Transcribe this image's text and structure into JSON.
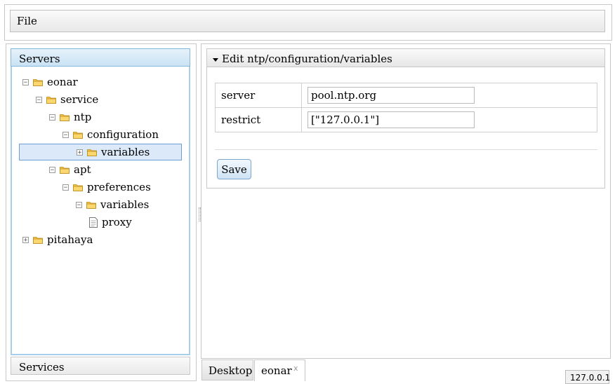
{
  "menu": {
    "file_label": "File"
  },
  "left_panel": {
    "servers_header": "Servers",
    "services_header": "Services",
    "tree": [
      {
        "label": "eonar",
        "type": "folder",
        "expander": "−"
      },
      {
        "label": "service",
        "type": "folder",
        "expander": "−"
      },
      {
        "label": "ntp",
        "type": "folder",
        "expander": "−"
      },
      {
        "label": "configuration",
        "type": "folder",
        "expander": "−"
      },
      {
        "label": "variables",
        "type": "folder",
        "expander": "+",
        "selected": true
      },
      {
        "label": "apt",
        "type": "folder",
        "expander": "−"
      },
      {
        "label": "preferences",
        "type": "folder",
        "expander": "−"
      },
      {
        "label": "variables",
        "type": "folder",
        "expander": "−"
      },
      {
        "label": "proxy",
        "type": "file"
      },
      {
        "label": "pitahaya",
        "type": "folder",
        "expander": "+"
      }
    ]
  },
  "editor": {
    "title": "Edit ntp/configuration/variables",
    "rows": [
      {
        "key": "server",
        "value": "pool.ntp.org"
      },
      {
        "key": "restrict",
        "value": "[\"127.0.0.1\"]"
      }
    ],
    "save_label": "Save"
  },
  "tabs": [
    {
      "label": "Desktop"
    },
    {
      "label": "eonar",
      "active": true,
      "close": "x"
    }
  ],
  "status": {
    "ip": "127.0.0.1"
  },
  "colors": {
    "selection_bg": "#dce9f8",
    "selection_border": "#6d9fd6",
    "folder": "#f5c242",
    "accordion_active": "#c9e2f4"
  },
  "icons": {
    "folder": "folder-icon",
    "file": "document-icon",
    "collapse": "collapse-arrow-icon",
    "close": "close-icon"
  }
}
